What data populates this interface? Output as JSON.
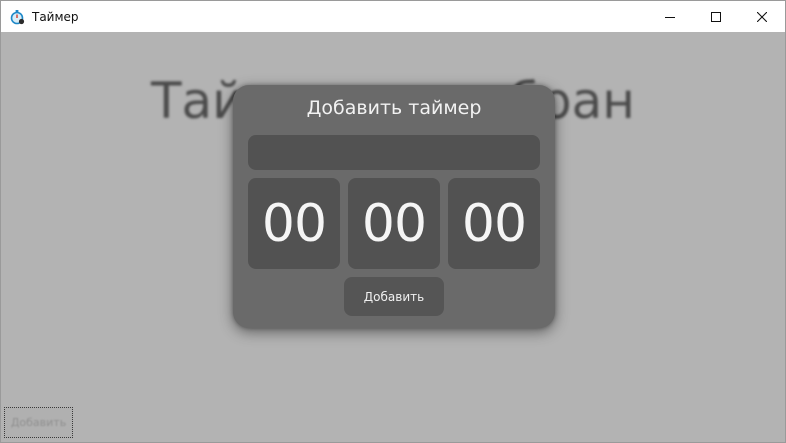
{
  "window": {
    "title": "Таймер",
    "icon": "stopwatch-icon"
  },
  "controls": {
    "minimize_icon": "minimize-icon",
    "maximize_icon": "maximize-icon",
    "close_icon": "close-icon"
  },
  "main": {
    "placeholder_text": "Таймер не выбран",
    "add_button_label": "Добавить"
  },
  "dialog": {
    "title": "Добавить таймер",
    "name_value": "",
    "hours": "00",
    "minutes": "00",
    "seconds": "00",
    "add_button_label": "Добавить"
  },
  "colors": {
    "overlay": "#b3b3b3",
    "dialog_bg": "#6a6a6a",
    "field_bg": "#525252",
    "accent": "#1e88c8"
  }
}
